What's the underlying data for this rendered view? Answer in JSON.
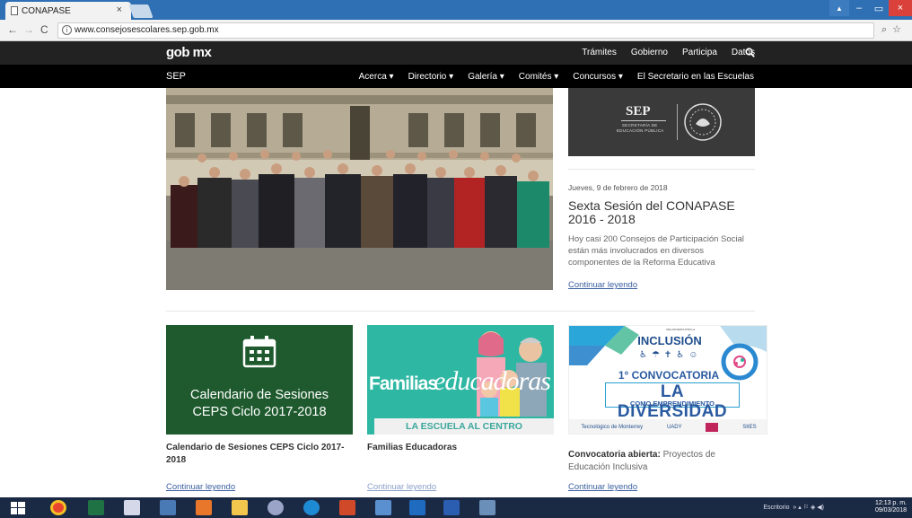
{
  "browser": {
    "tab_title": "CONAPASE",
    "tab_close": "×",
    "url": "www.consejosescolares.sep.gob.mx",
    "info": "i",
    "right_icons": "⌕☆",
    "window_controls": [
      "▲",
      "–",
      "▭",
      "×"
    ]
  },
  "gob_bar": {
    "logo": "gob mx",
    "nav": [
      "Trámites",
      "Gobierno",
      "Participa",
      "Datos"
    ],
    "search_icon": "magnifier"
  },
  "sep_bar": {
    "logo": "SEP",
    "nav": [
      "Acerca",
      "Directorio",
      "Galería",
      "Comités",
      "Concursos",
      "El Secretario en las Escuelas"
    ]
  },
  "seal": {
    "title": "SEP",
    "subtitle1": "SECRETARÍA DE",
    "subtitle2": "EDUCACIÓN PÚBLICA"
  },
  "news": {
    "date": "Jueves, 9 de febrero de 2018",
    "title": "Sexta Sesión del CONAPASE 2016 - 2018",
    "description": "Hoy casi 200 Consejos de Participación Social están más involucrados en diversos componentes de la Reforma Educativa",
    "link": "Continuar leyendo"
  },
  "cards": [
    {
      "image_text1": "Calendario de Sesiones",
      "image_text2": "CEPS Ciclo 2017-2018",
      "title": "Calendario de Sesiones CEPS Ciclo 2017-2018",
      "link": "Continuar leyendo"
    },
    {
      "image_text1": "Familias",
      "image_text2": "educadoras",
      "image_text3": "LA ESCUELA AL CENTRO",
      "title": "Familias Educadoras",
      "link": "Continuar leyendo"
    },
    {
      "image_text0": "UNA APUESTA POR LA",
      "image_text1": "INCLUSIÓN",
      "image_text2": "1° CONVOCATORIA",
      "image_text3": "LA DIVERSIDAD",
      "image_text4": "COMO EMPRENDIMIENTO",
      "logos": [
        "Tecnológico de Monterrey",
        "UADY",
        "SIIES"
      ],
      "title_bold": "Convocatoria abierta:",
      "title_rest": " Proyectos de Educación Inclusiva",
      "link": "Continuar leyendo"
    }
  ],
  "taskbar": {
    "tray_label": "Escritorio",
    "time": "12:13 p. m.",
    "date": "09/03/2018"
  },
  "colors": {
    "gob_bar": "#222222",
    "sep_bar": "#000000",
    "card1_bg": "#1e5a2e",
    "card2_bg": "#2eb7a3",
    "link": "#3a5fa0",
    "taskbar": "#1b2a44"
  }
}
